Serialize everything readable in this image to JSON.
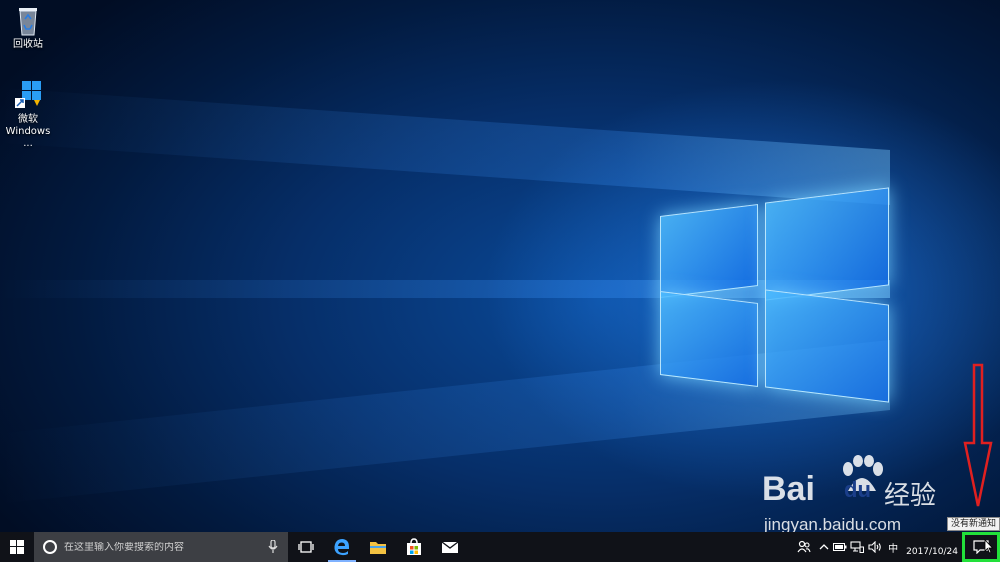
{
  "desktop": {
    "icons": [
      {
        "label": "回收站",
        "icon": "recycle-bin-icon"
      },
      {
        "label": "微软\nWindows ...",
        "label_line1": "微软",
        "label_line2": "Windows ...",
        "icon": "windows-installer-icon"
      }
    ]
  },
  "watermark": {
    "brand": "Bai",
    "brand_du": "du",
    "brand_cn": "经验",
    "url": "jingyan.baidu.com"
  },
  "tooltip": {
    "text": "没有新通知"
  },
  "taskbar": {
    "search_placeholder": "在这里输入你要搜索的内容",
    "apps": [
      {
        "name": "edge",
        "icon": "edge-browser-icon",
        "active": true
      },
      {
        "name": "explorer",
        "icon": "file-explorer-icon",
        "active": false
      },
      {
        "name": "store",
        "icon": "store-icon",
        "active": false
      },
      {
        "name": "mail",
        "icon": "mail-icon",
        "active": false
      }
    ],
    "tray": {
      "ime": "中",
      "date": "2017/10/24"
    }
  },
  "colors": {
    "taskbar_bg": "#101218",
    "search_bg": "#3d3f44",
    "highlight_green": "#22e03a",
    "arrow_red": "#e02020"
  }
}
